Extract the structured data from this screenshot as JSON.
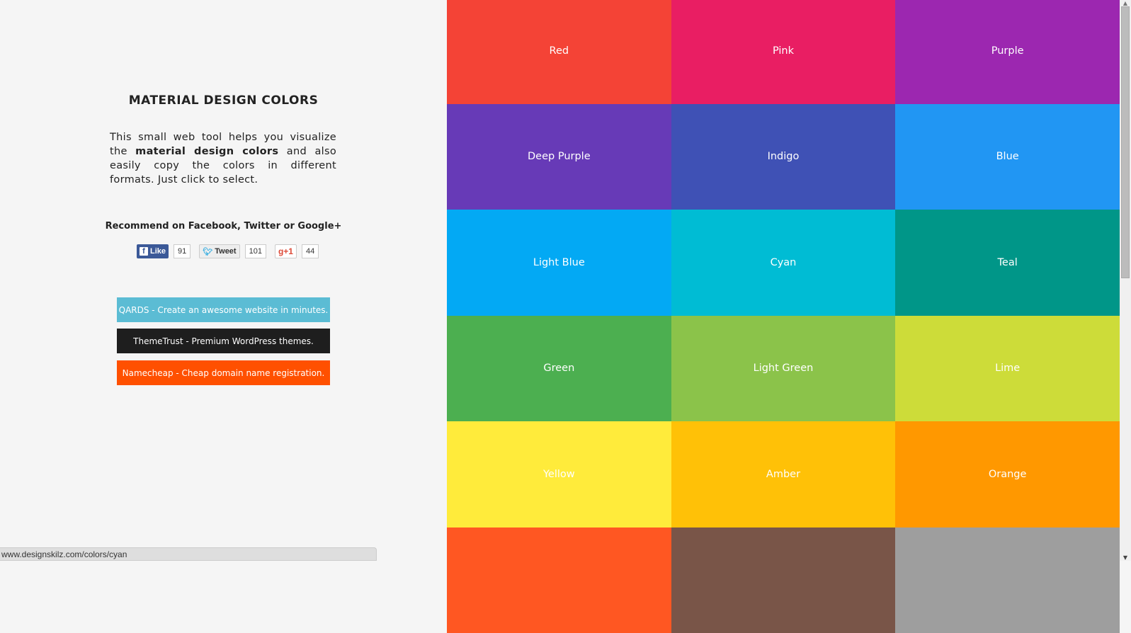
{
  "left": {
    "title": "MATERIAL DESIGN COLORS",
    "intro_pre": "This small web tool helps you visualize the ",
    "intro_bold": "material design colors",
    "intro_post": " and also easily copy the colors in different formats. Just click to select.",
    "recommend": "Recommend on Facebook, Twitter or Google+",
    "social": {
      "facebook": {
        "label": "Like",
        "count": "91",
        "icon": "facebook-icon"
      },
      "twitter": {
        "label": "Tweet",
        "count": "101",
        "icon": "twitter-bird-icon"
      },
      "google": {
        "label": "g+1",
        "count": "44"
      }
    },
    "ads": [
      {
        "label": "QARDS - Create an awesome website in minutes.",
        "color": "#5bbcd4"
      },
      {
        "label": "ThemeTrust - Premium WordPress themes.",
        "color": "#1e1e1e"
      },
      {
        "label": "Namecheap - Cheap domain name registration.",
        "color": "#ff5000"
      }
    ]
  },
  "colors": [
    {
      "name": "Red",
      "hex": "#f44336"
    },
    {
      "name": "Pink",
      "hex": "#e91e63"
    },
    {
      "name": "Purple",
      "hex": "#9c27b0"
    },
    {
      "name": "Deep Purple",
      "hex": "#673ab7"
    },
    {
      "name": "Indigo",
      "hex": "#3f51b5"
    },
    {
      "name": "Blue",
      "hex": "#2196f3"
    },
    {
      "name": "Light Blue",
      "hex": "#03a9f4"
    },
    {
      "name": "Cyan",
      "hex": "#00bcd4"
    },
    {
      "name": "Teal",
      "hex": "#009688"
    },
    {
      "name": "Green",
      "hex": "#4caf50"
    },
    {
      "name": "Light Green",
      "hex": "#8bc34a"
    },
    {
      "name": "Lime",
      "hex": "#cddc39"
    },
    {
      "name": "Yellow",
      "hex": "#ffeb3b"
    },
    {
      "name": "Amber",
      "hex": "#ffc107"
    },
    {
      "name": "Orange",
      "hex": "#ff9800"
    },
    {
      "name": "",
      "hex": "#ff5722"
    },
    {
      "name": "",
      "hex": "#795548"
    },
    {
      "name": "",
      "hex": "#9e9e9e"
    }
  ],
  "status_bar": "www.designskilz.com/colors/cyan"
}
